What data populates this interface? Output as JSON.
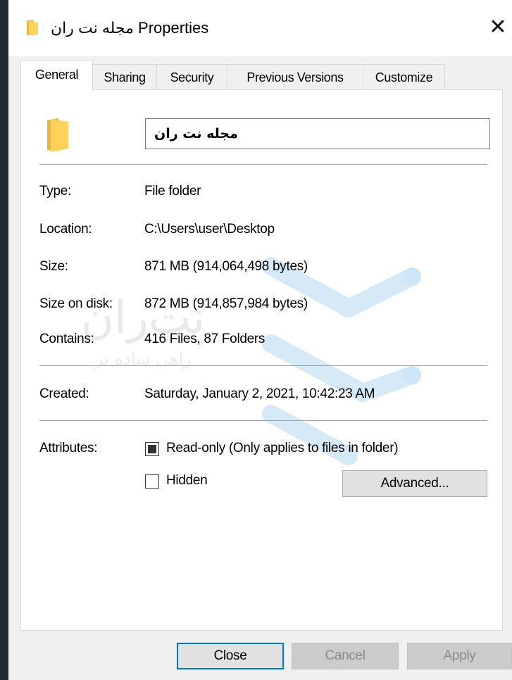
{
  "window": {
    "title": "مجله نت ران Properties",
    "close_glyph": "✕"
  },
  "tabs": [
    {
      "label": "General",
      "active": true
    },
    {
      "label": "Sharing",
      "active": false
    },
    {
      "label": "Security",
      "active": false
    },
    {
      "label": "Previous Versions",
      "active": false
    },
    {
      "label": "Customize",
      "active": false
    }
  ],
  "general": {
    "folder_name": "مجله نت ران",
    "rows": [
      {
        "label": "Type:",
        "value": "File folder"
      },
      {
        "label": "Location:",
        "value": "C:\\Users\\user\\Desktop"
      },
      {
        "label": "Size:",
        "value": "871 MB (914,064,498 bytes)"
      },
      {
        "label": "Size on disk:",
        "value": "872 MB (914,857,984 bytes)"
      },
      {
        "label": "Contains:",
        "value": "416 Files, 87 Folders"
      },
      {
        "label": "Created:",
        "value": "Saturday, January 2, 2021, 10:42:23 AM"
      }
    ],
    "attributes_label": "Attributes:",
    "readonly_label": "Read-only (Only applies to files in folder)",
    "readonly_state": "indeterminate",
    "hidden_label": "Hidden",
    "hidden_checked": false,
    "advanced_label": "Advanced..."
  },
  "watermark": {
    "brand": "نت‌ران",
    "tagline": "راهی ساده تر"
  },
  "footer": {
    "close_label": "Close",
    "cancel_label": "Cancel",
    "apply_label": "Apply"
  },
  "colors": {
    "folder_yellow": "#ffd25e",
    "folder_dark": "#e8b73d",
    "accent_blue": "#0078d7",
    "watermark_blue": "#cfe6f6"
  }
}
